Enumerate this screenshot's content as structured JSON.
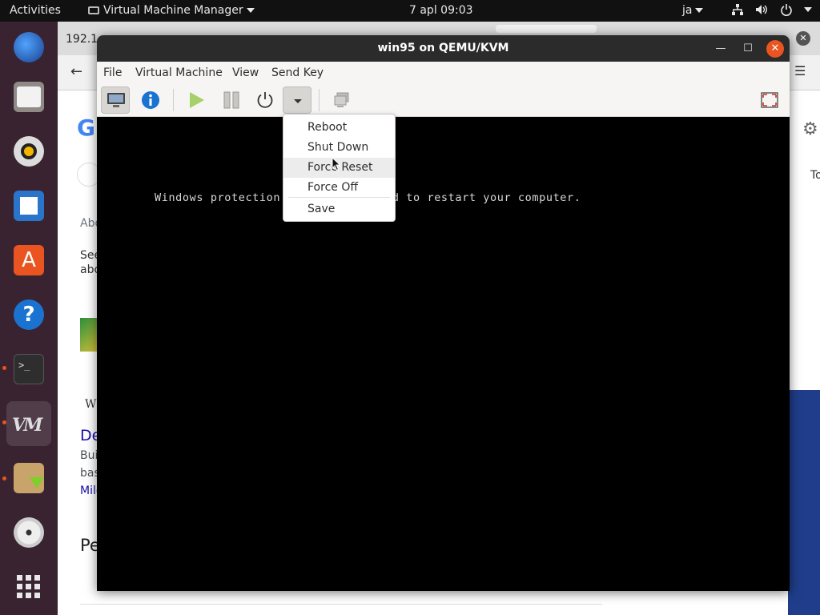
{
  "topbar": {
    "activities": "Activities",
    "app_name": "Virtual Machine Manager",
    "clock": "7 apl  09:03",
    "input_source": "ja"
  },
  "browser": {
    "tab_fragment": "192.1",
    "heading_fragment": "Pe",
    "link_fragment": "De",
    "text_fragments": [
      "Abo",
      "See",
      "abo",
      "Bui",
      "bas",
      "Mile",
      "W",
      "To"
    ]
  },
  "window": {
    "title": "win95 on QEMU/KVM"
  },
  "menubar": {
    "items": [
      "File",
      "Virtual Machine",
      "View",
      "Send Key"
    ]
  },
  "toolbar": {
    "buttons": [
      "console-icon",
      "info-icon",
      "run-icon",
      "pause-icon",
      "power-icon",
      "dropdown-arrow-icon",
      "screenshot-icon",
      "fullscreen-icon"
    ]
  },
  "console": {
    "line": "Windows protection",
    "line_tail": "ed to restart your computer."
  },
  "shutdown_menu": {
    "items": [
      "Reboot",
      "Shut Down",
      "Force Reset",
      "Force Off",
      "Save"
    ],
    "highlighted": "Force Reset"
  },
  "colors": {
    "accent": "#e95420",
    "dock_bg": "#3a2331",
    "topbar_bg": "#111111",
    "titlebar_bg": "#2b2b2b",
    "info_blue": "#1b73d1"
  },
  "dock": {
    "apps": [
      "thunderbird-icon",
      "files-icon",
      "rhythmbox-icon",
      "writer-icon",
      "software-icon",
      "help-icon",
      "terminal-icon",
      "virt-manager-icon",
      "archive-installer-icon",
      "disc-icon",
      "app-grid-icon"
    ]
  }
}
